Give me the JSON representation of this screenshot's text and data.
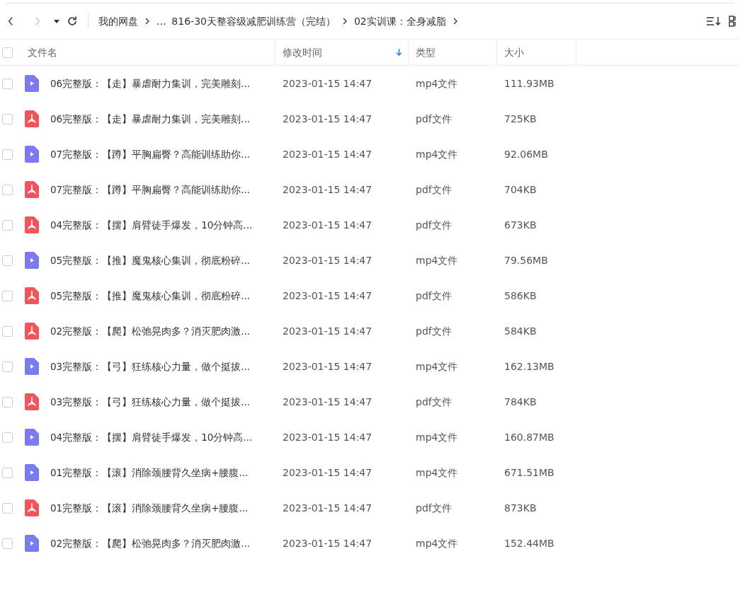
{
  "toolbar": {
    "back_disabled": false,
    "forward_disabled": true
  },
  "breadcrumb": [
    "我的网盘",
    "...",
    "816-30天整容级减肥训练营（完结）",
    "02实训课：全身减脂"
  ],
  "header": {
    "checked": false,
    "columns": [
      {
        "label": "文件名",
        "sorted": false
      },
      {
        "label": "修改时间",
        "sorted": true
      },
      {
        "label": "类型",
        "sorted": false
      },
      {
        "label": "大小",
        "sorted": false
      }
    ]
  },
  "files": [
    {
      "kind": "video",
      "name": "06完整版：【走】暴虐耐力集训，完美雕刻...",
      "modified": "2023-01-15 14:47",
      "type": "mp4文件",
      "size": "111.93MB",
      "checked": false
    },
    {
      "kind": "pdf",
      "name": "06完整版：【走】暴虐耐力集训，完美雕刻...",
      "modified": "2023-01-15 14:47",
      "type": "pdf文件",
      "size": "725KB",
      "checked": false
    },
    {
      "kind": "video",
      "name": "07完整版：【蹲】平胸扁臀？高能训练助你...",
      "modified": "2023-01-15 14:47",
      "type": "mp4文件",
      "size": "92.06MB",
      "checked": false
    },
    {
      "kind": "pdf",
      "name": "07完整版：【蹲】平胸扁臀？高能训练助你...",
      "modified": "2023-01-15 14:47",
      "type": "pdf文件",
      "size": "704KB",
      "checked": false
    },
    {
      "kind": "pdf",
      "name": "04完整版：【摆】肩臂徒手爆发，10分钟高...",
      "modified": "2023-01-15 14:47",
      "type": "pdf文件",
      "size": "673KB",
      "checked": false
    },
    {
      "kind": "video",
      "name": "05完整版：【推】魔鬼核心集训，彻底粉碎...",
      "modified": "2023-01-15 14:47",
      "type": "mp4文件",
      "size": "79.56MB",
      "checked": false
    },
    {
      "kind": "pdf",
      "name": "05完整版：【推】魔鬼核心集训，彻底粉碎...",
      "modified": "2023-01-15 14:47",
      "type": "pdf文件",
      "size": "586KB",
      "checked": false
    },
    {
      "kind": "pdf",
      "name": "02完整版：【爬】松弛晃肉多？消灭肥肉激...",
      "modified": "2023-01-15 14:47",
      "type": "pdf文件",
      "size": "584KB",
      "checked": false
    },
    {
      "kind": "video",
      "name": "03完整版：【弓】狂练核心力量，做个挺拔...",
      "modified": "2023-01-15 14:47",
      "type": "mp4文件",
      "size": "162.13MB",
      "checked": false
    },
    {
      "kind": "pdf",
      "name": "03完整版：【弓】狂练核心力量，做个挺拔...",
      "modified": "2023-01-15 14:47",
      "type": "pdf文件",
      "size": "784KB",
      "checked": false
    },
    {
      "kind": "video",
      "name": "04完整版：【摆】肩臂徒手爆发，10分钟高...",
      "modified": "2023-01-15 14:47",
      "type": "mp4文件",
      "size": "160.87MB",
      "checked": false
    },
    {
      "kind": "video",
      "name": "01完整版：【滚】消除颈腰背久坐病+腰腹...",
      "modified": "2023-01-15 14:47",
      "type": "mp4文件",
      "size": "671.51MB",
      "checked": false
    },
    {
      "kind": "pdf",
      "name": "01完整版：【滚】消除颈腰背久坐病+腰腹...",
      "modified": "2023-01-15 14:47",
      "type": "pdf文件",
      "size": "873KB",
      "checked": false
    },
    {
      "kind": "video",
      "name": "02完整版：【爬】松弛晃肉多？消灭肥肉激...",
      "modified": "2023-01-15 14:47",
      "type": "mp4文件",
      "size": "152.44MB",
      "checked": false
    }
  ]
}
